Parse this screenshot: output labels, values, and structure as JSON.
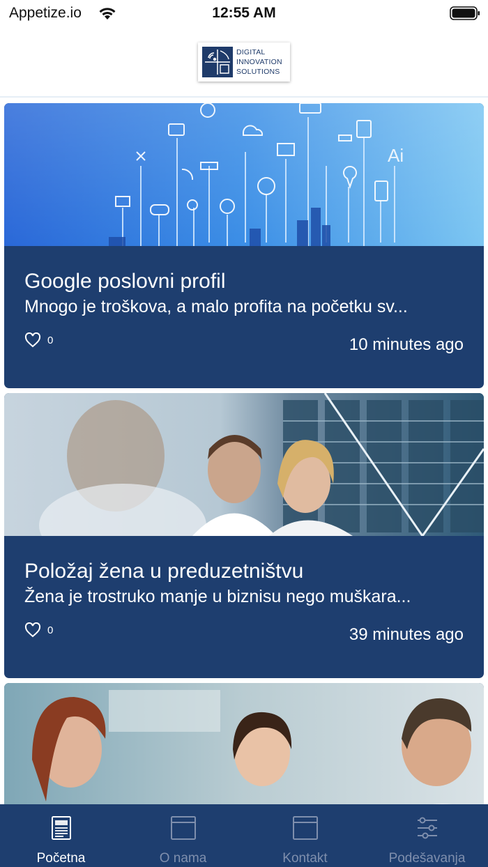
{
  "status_bar": {
    "carrier": "Appetize.io",
    "time": "12:55 AM"
  },
  "header": {
    "logo_lines": [
      "DIGITAL",
      "INNOVATION",
      "SOLUTIONS"
    ]
  },
  "posts": [
    {
      "title": "Google poslovni profil",
      "excerpt": "Mnogo je troškova, a malo profita na početku sv...",
      "likes": "0",
      "time": "10 minutes ago"
    },
    {
      "title": "Položaj žena u preduzetništvu",
      "excerpt": "Žena je trostruko manje u biznisu nego muškara...",
      "likes": "0",
      "time": "39 minutes ago"
    }
  ],
  "tabs": [
    {
      "label": "Početna",
      "icon": "newspaper-icon",
      "active": true
    },
    {
      "label": "O nama",
      "icon": "window-icon",
      "active": false
    },
    {
      "label": "Kontakt",
      "icon": "window-icon",
      "active": false
    },
    {
      "label": "Podešavanja",
      "icon": "sliders-icon",
      "active": false
    }
  ],
  "colors": {
    "brand_navy": "#1e3e6f",
    "tab_inactive": "#7f8fad",
    "tab_active": "#ffffff"
  }
}
